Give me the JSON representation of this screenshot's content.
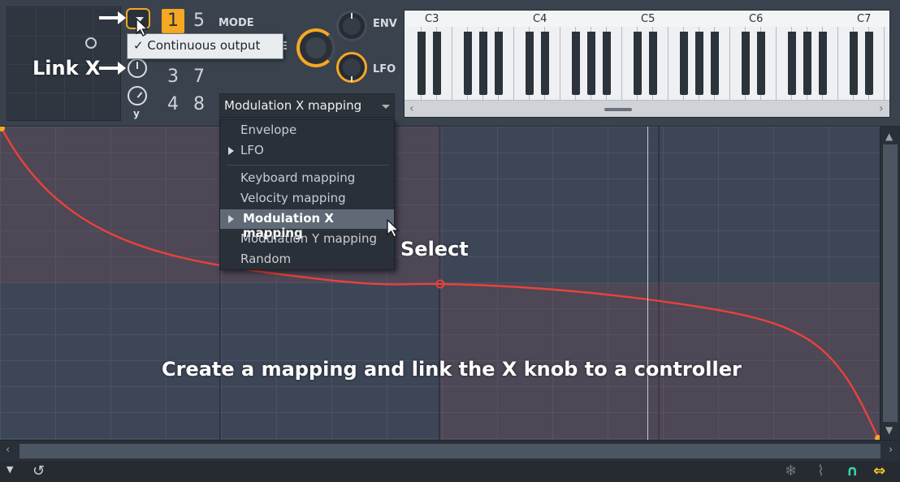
{
  "mode": {
    "label": "MODE",
    "numbers": [
      "1",
      "5",
      "3",
      "7",
      "4",
      "8"
    ],
    "active": "1",
    "tension_label_fragment": "E"
  },
  "knobs": {
    "y_label": "y",
    "env_label": "ENV",
    "lfo_label": "LFO"
  },
  "link_button": {
    "icon": "chevron-down-icon"
  },
  "continuous_menu": {
    "checkmark": "✓",
    "label": "Continuous output"
  },
  "mapping_select": {
    "value": "Modulation X mapping"
  },
  "context_menu": {
    "items": [
      {
        "label": "Envelope",
        "submenu": false,
        "highlighted": false
      },
      {
        "label": "LFO",
        "submenu": true,
        "highlighted": false
      },
      {
        "label": "Keyboard mapping",
        "submenu": false,
        "highlighted": false
      },
      {
        "label": "Velocity mapping",
        "submenu": false,
        "highlighted": false
      },
      {
        "label": "Modulation X mapping",
        "submenu": true,
        "highlighted": true
      },
      {
        "label": "Modulation Y mapping",
        "submenu": false,
        "highlighted": false
      },
      {
        "label": "Random",
        "submenu": false,
        "highlighted": false
      }
    ]
  },
  "piano": {
    "octaves": [
      "C3",
      "C4",
      "C5",
      "C6",
      "C7"
    ],
    "scroll_left": "‹",
    "scroll_right": "›"
  },
  "scrollbars": {
    "up": "▲",
    "down": "▼",
    "left": "‹",
    "right": "›"
  },
  "status_bar": {
    "menu_icon": "▼",
    "reset_icon": "↺",
    "snowflake_icon": "❄",
    "paperclip_icon": "⌇",
    "magnet_icon": "∩",
    "arrows_icon": "⇔"
  },
  "annotations": {
    "link_x": "Link X",
    "select": "Select",
    "caption": "Create a mapping and link the X knob to a controller"
  },
  "colors": {
    "accent": "#f6a823",
    "curve": "#e8423c",
    "highlight": "#5f6a76"
  }
}
